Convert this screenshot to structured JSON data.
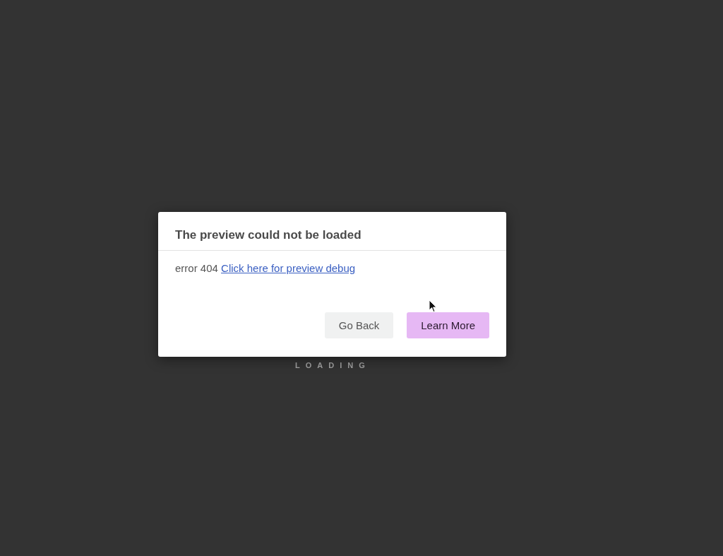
{
  "background": {
    "loading_label": "LOADING"
  },
  "dialog": {
    "title": "The preview could not be loaded",
    "message": "error 404",
    "link": "Click here for preview debug",
    "buttons": [
      {
        "label": "Go Back",
        "kind": "secondary"
      },
      {
        "label": "Learn More",
        "kind": "primary"
      }
    ]
  }
}
